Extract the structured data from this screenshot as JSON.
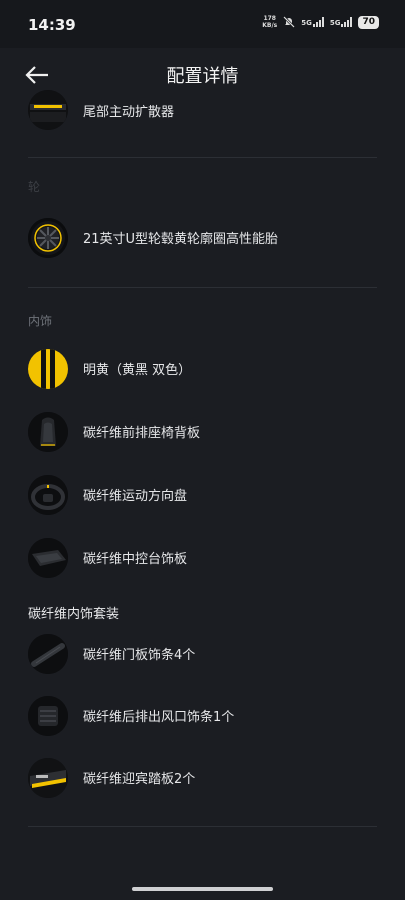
{
  "status": {
    "time": "14:39",
    "net_speed_value": "178",
    "net_speed_unit": "KB/s",
    "sig1": "5G",
    "sig2": "5G",
    "battery": "70"
  },
  "header": {
    "title": "配置详情"
  },
  "items": [
    {
      "label": "尾部主动扩散器",
      "icon": "rear-diffuser-thumbnail"
    },
    {
      "label": "21英寸U型轮毂黄轮廓圈高性能胎",
      "icon": "wheel-thumbnail"
    },
    {
      "label": "明黄（黄黑 双色）",
      "icon": "yellow-black-swatch"
    },
    {
      "label": "碳纤维前排座椅背板",
      "icon": "seat-back-thumbnail"
    },
    {
      "label": "碳纤维运动方向盘",
      "icon": "steering-wheel-thumbnail"
    },
    {
      "label": "碳纤维中控台饰板",
      "icon": "console-trim-thumbnail"
    },
    {
      "label": "碳纤维门板饰条4个",
      "icon": "door-trim-thumbnail"
    },
    {
      "label": "碳纤维后排出风口饰条1个",
      "icon": "rear-vent-thumbnail"
    },
    {
      "label": "碳纤维迎宾踏板2个",
      "icon": "door-sill-thumbnail"
    }
  ],
  "sections": {
    "faded": "轮",
    "interior": "内饰",
    "carbon_kit": "碳纤维内饰套装"
  },
  "colors": {
    "accent_yellow": "#f2c200",
    "background": "#1b1d22"
  }
}
